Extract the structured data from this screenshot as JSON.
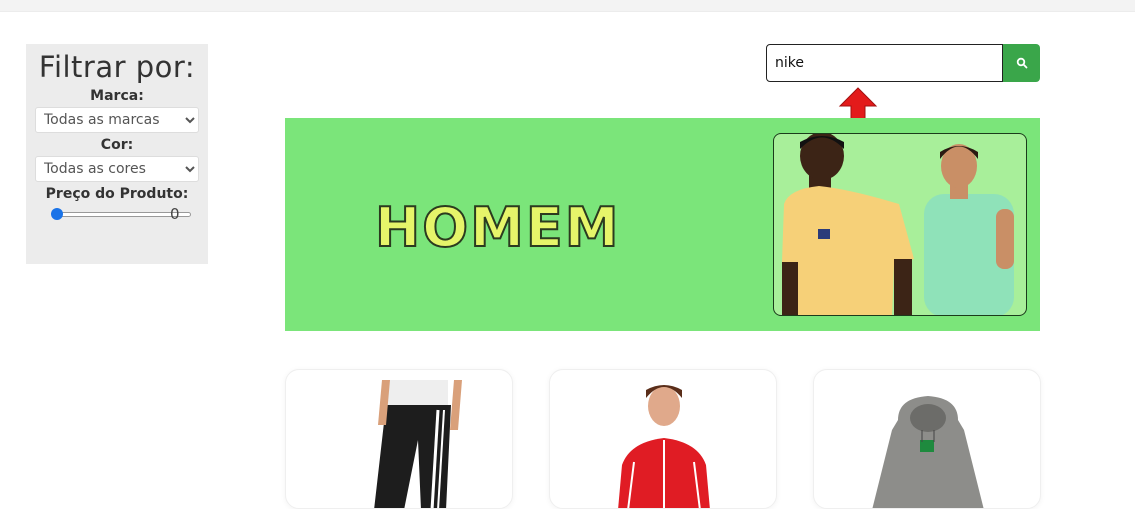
{
  "filter": {
    "title": "Filtrar por:",
    "brand_label": "Marca:",
    "brand_selected": "Todas as marcas",
    "color_label": "Cor:",
    "color_selected": "Todas as cores",
    "price_label": "Preço do Produto:",
    "price_value": "0",
    "price_level": 0
  },
  "search": {
    "value": "nike",
    "icon": "search-icon"
  },
  "banner": {
    "title": "HOMEM"
  },
  "colors": {
    "accent_green": "#3aa64a",
    "banner_green": "#7be57a",
    "arrow_red": "#e31b1b"
  },
  "products": [
    {
      "image": "black-track-pants"
    },
    {
      "image": "red-track-jacket"
    },
    {
      "image": "grey-hoodie"
    }
  ]
}
